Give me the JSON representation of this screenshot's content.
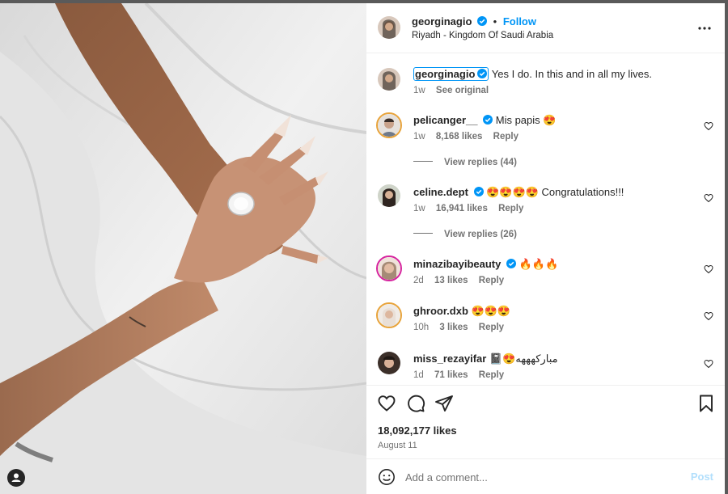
{
  "post": {
    "author": "georginagio",
    "follow_label": "Follow",
    "location": "Riyadh - Kingdom Of Saudi Arabia",
    "caption": {
      "author": "georginagio",
      "text": "Yes I do. In this and in all my lives.",
      "time": "1w",
      "see_original": "See original"
    }
  },
  "comments": [
    {
      "user": "pelicanger__",
      "verified": true,
      "text": "Mis papis 😍",
      "time": "1w",
      "likes": "8,168 likes",
      "reply": "Reply",
      "view_replies": "View replies (44)"
    },
    {
      "user": "celine.dept",
      "verified": true,
      "text": "😍😍😍😍 Congratulations!!!",
      "time": "1w",
      "likes": "16,941 likes",
      "reply": "Reply",
      "view_replies": "View replies (26)"
    },
    {
      "user": "minazibayibeauty",
      "verified": true,
      "text": "🔥🔥🔥",
      "time": "2d",
      "likes": "13 likes",
      "reply": "Reply"
    },
    {
      "user": "ghroor.dxb",
      "verified": false,
      "text": "😍😍😍",
      "time": "10h",
      "likes": "3 likes",
      "reply": "Reply"
    },
    {
      "user": "miss_rezayifar",
      "verified": false,
      "text": "📓😍مبارکهههه",
      "time": "1d",
      "likes": "71 likes",
      "reply": "Reply"
    }
  ],
  "footer": {
    "likes": "18,092,177 likes",
    "date": "August 11",
    "comment_placeholder": "Add a comment...",
    "post_label": "Post"
  },
  "colors": {
    "accent": "#0095f6",
    "muted": "#737373",
    "text": "#262626"
  }
}
